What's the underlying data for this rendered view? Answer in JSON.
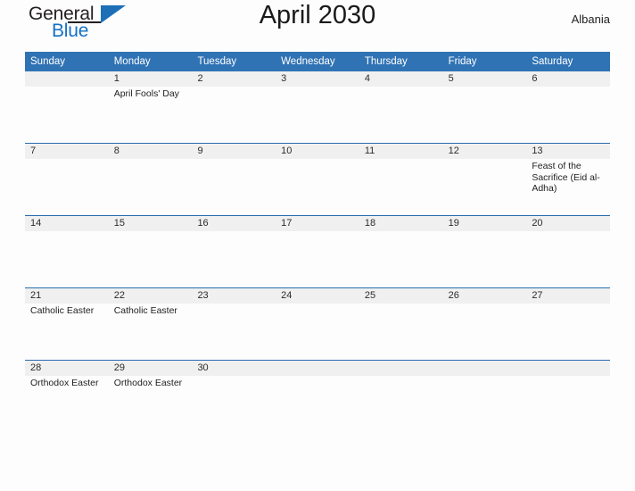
{
  "branding": {
    "logo_text_primary": "General",
    "logo_text_secondary": "Blue",
    "logo_icon": "blue-triangle-flag-icon"
  },
  "header": {
    "title": "April 2030",
    "region": "Albania"
  },
  "colors": {
    "header_blue": "#3073b4",
    "row_border_blue": "#2b6cad",
    "date_band_gray": "#f0f0f0",
    "logo_blue": "#1471c4",
    "page_background": "#fdfdfd"
  },
  "calendar": {
    "weekday_headers": [
      "Sunday",
      "Monday",
      "Tuesday",
      "Wednesday",
      "Thursday",
      "Friday",
      "Saturday"
    ],
    "weeks": [
      {
        "days": [
          {
            "date": "",
            "event": ""
          },
          {
            "date": "1",
            "event": "April Fools' Day"
          },
          {
            "date": "2",
            "event": ""
          },
          {
            "date": "3",
            "event": ""
          },
          {
            "date": "4",
            "event": ""
          },
          {
            "date": "5",
            "event": ""
          },
          {
            "date": "6",
            "event": ""
          }
        ]
      },
      {
        "days": [
          {
            "date": "7",
            "event": ""
          },
          {
            "date": "8",
            "event": ""
          },
          {
            "date": "9",
            "event": ""
          },
          {
            "date": "10",
            "event": ""
          },
          {
            "date": "11",
            "event": ""
          },
          {
            "date": "12",
            "event": ""
          },
          {
            "date": "13",
            "event": "Feast of the Sacrifice (Eid al-Adha)"
          }
        ]
      },
      {
        "days": [
          {
            "date": "14",
            "event": ""
          },
          {
            "date": "15",
            "event": ""
          },
          {
            "date": "16",
            "event": ""
          },
          {
            "date": "17",
            "event": ""
          },
          {
            "date": "18",
            "event": ""
          },
          {
            "date": "19",
            "event": ""
          },
          {
            "date": "20",
            "event": ""
          }
        ]
      },
      {
        "days": [
          {
            "date": "21",
            "event": "Catholic Easter"
          },
          {
            "date": "22",
            "event": "Catholic Easter"
          },
          {
            "date": "23",
            "event": ""
          },
          {
            "date": "24",
            "event": ""
          },
          {
            "date": "25",
            "event": ""
          },
          {
            "date": "26",
            "event": ""
          },
          {
            "date": "27",
            "event": ""
          }
        ]
      },
      {
        "days": [
          {
            "date": "28",
            "event": "Orthodox Easter"
          },
          {
            "date": "29",
            "event": "Orthodox Easter"
          },
          {
            "date": "30",
            "event": ""
          },
          {
            "date": "",
            "event": ""
          },
          {
            "date": "",
            "event": ""
          },
          {
            "date": "",
            "event": ""
          },
          {
            "date": "",
            "event": ""
          }
        ]
      }
    ]
  }
}
